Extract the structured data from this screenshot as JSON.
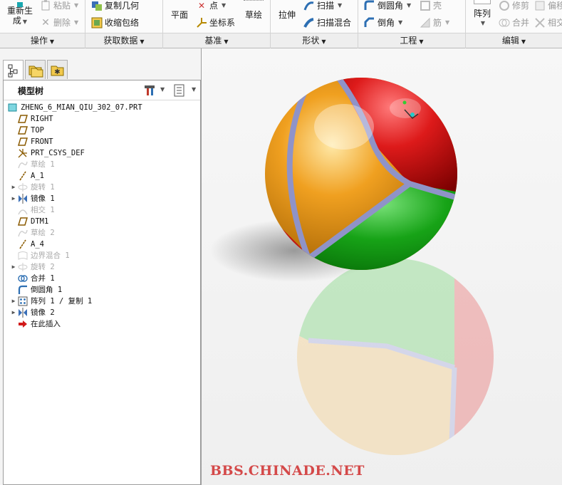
{
  "ribbon": {
    "groups": {
      "operations": {
        "label": "操作",
        "regenerate": "重新生",
        "regenerate2": "成",
        "paste": "粘贴",
        "delete": "删除"
      },
      "get_data": {
        "label": "获取数据",
        "copy_geometry": "复制几何",
        "shrinkwrap": "收缩包络"
      },
      "datum": {
        "label": "基准",
        "plane": "平面",
        "point": "点",
        "csys": "坐标系",
        "sketch": "草绘"
      },
      "shapes": {
        "label": "形状",
        "extrude": "拉伸",
        "sweep": "扫描",
        "swept_blend": "扫描混合"
      },
      "engineering": {
        "label": "工程",
        "round": "倒圆角",
        "chamfer": "倒角",
        "shell": "壳",
        "rib": "筋"
      },
      "editing": {
        "label": "编辑",
        "pattern": "阵列",
        "trim": "修剪",
        "merge": "合并",
        "offset": "偏移",
        "intersect": "相交"
      }
    }
  },
  "panel": {
    "tree_title": "模型树",
    "items": [
      {
        "label": "ZHENG_6_MIAN_QIU_302_07.PRT",
        "icon": "part-icon",
        "dim": false,
        "expander": false
      },
      {
        "label": "RIGHT",
        "icon": "datum-plane-icon",
        "dim": false,
        "expander": false
      },
      {
        "label": "TOP",
        "icon": "datum-plane-icon",
        "dim": false,
        "expander": false
      },
      {
        "label": "FRONT",
        "icon": "datum-plane-icon",
        "dim": false,
        "expander": false
      },
      {
        "label": "PRT_CSYS_DEF",
        "icon": "csys-icon",
        "dim": false,
        "expander": false
      },
      {
        "label": "草绘 1",
        "icon": "sketch-icon",
        "dim": true,
        "expander": false
      },
      {
        "label": "A_1",
        "icon": "axis-icon",
        "dim": false,
        "expander": false
      },
      {
        "label": "旋转 1",
        "icon": "revolve-icon",
        "dim": true,
        "expander": true
      },
      {
        "label": "镜像 1",
        "icon": "mirror-icon",
        "dim": false,
        "expander": true
      },
      {
        "label": "相交 1",
        "icon": "intersect-icon",
        "dim": true,
        "expander": false
      },
      {
        "label": "DTM1",
        "icon": "datum-plane-icon",
        "dim": false,
        "expander": false
      },
      {
        "label": "草绘 2",
        "icon": "sketch-icon",
        "dim": true,
        "expander": false
      },
      {
        "label": "A_4",
        "icon": "axis-icon",
        "dim": false,
        "expander": false
      },
      {
        "label": "边界混合 1",
        "icon": "boundary-blend-icon",
        "dim": true,
        "expander": false
      },
      {
        "label": "旋转 2",
        "icon": "revolve-icon",
        "dim": true,
        "expander": true
      },
      {
        "label": "合并 1",
        "icon": "merge-icon",
        "dim": false,
        "expander": false
      },
      {
        "label": "倒圆角 1",
        "icon": "round-icon",
        "dim": false,
        "expander": false
      },
      {
        "label": "阵列 1 / 复制 1",
        "icon": "pattern-icon",
        "dim": false,
        "expander": true
      },
      {
        "label": "镜像 2",
        "icon": "mirror-icon",
        "dim": false,
        "expander": true
      },
      {
        "label": "在此插入",
        "icon": "insert-here-icon",
        "dim": false,
        "expander": false
      }
    ]
  },
  "colors": {
    "sphere_yellow": "#f0a020",
    "sphere_red": "#dd1a1a",
    "sphere_green": "#17a317",
    "seam": "#8f93c8",
    "watermark": "#d44949"
  },
  "watermark": "BBS.CHINADE.NET"
}
